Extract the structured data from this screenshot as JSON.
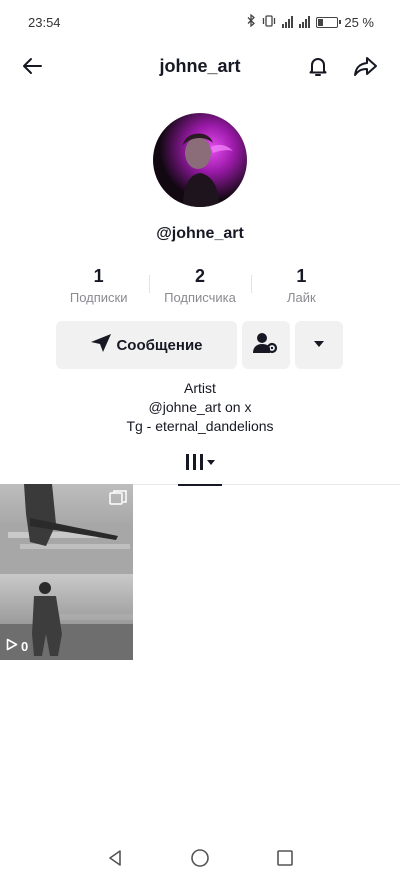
{
  "status_bar": {
    "time": "23:54",
    "battery": "25 %"
  },
  "header": {
    "title": "johne_art"
  },
  "profile": {
    "handle": "@johne_art",
    "stats": [
      {
        "value": "1",
        "label": "Подписки"
      },
      {
        "value": "2",
        "label": "Подписчика"
      },
      {
        "value": "1",
        "label": "Лайк"
      }
    ],
    "message_button": "Сообщение",
    "bio": [
      "Artist",
      "@johne_art on x",
      "Tg - eternal_dandelions"
    ]
  },
  "videos": [
    {
      "views": "0"
    }
  ],
  "colors": {
    "text": "#161823",
    "muted": "#8a8b91",
    "button_bg": "#f1f1f2",
    "avatar_accent": "#c21ed6"
  },
  "icons": [
    "back-arrow-icon",
    "bell-icon",
    "share-icon",
    "send-icon",
    "add-friend-icon",
    "chevron-down-icon",
    "grid-icon",
    "multi-image-icon",
    "play-icon"
  ]
}
